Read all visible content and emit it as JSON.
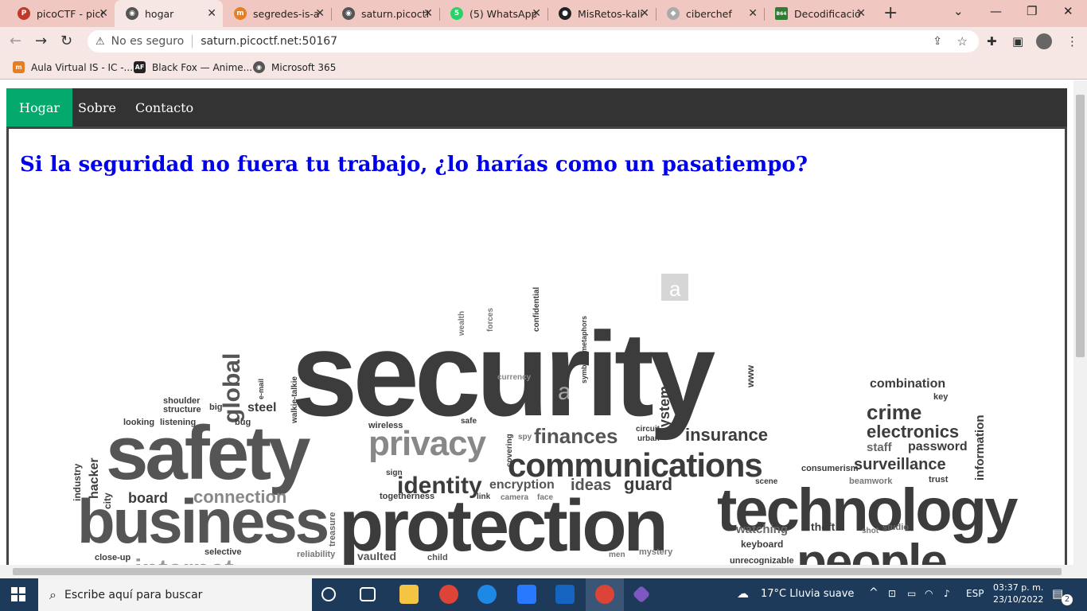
{
  "tabs": [
    {
      "title": "picoCTF - picoGym",
      "color": "#c0392b",
      "glyph": "P"
    },
    {
      "title": "hogar",
      "color": "#555",
      "glyph": "◉"
    },
    {
      "title": "segredes-is-a",
      "color": "#e67e22",
      "glyph": "m"
    },
    {
      "title": "saturn.picoctf",
      "color": "#555",
      "glyph": "◉"
    },
    {
      "title": "(5) WhatsApp",
      "color": "#25d366",
      "glyph": "5"
    },
    {
      "title": "MisRetos-kali",
      "color": "#222",
      "glyph": "●"
    },
    {
      "title": "ciberchef",
      "color": "#aaa",
      "glyph": "◆"
    },
    {
      "title": "Decodificación",
      "color": "#2e7d32",
      "glyph": "B64"
    }
  ],
  "address": {
    "security": "No es seguro",
    "url": "saturn.picoctf.net:50167"
  },
  "bookmarks": [
    {
      "label": "Aula Virtual IS - IC -...",
      "color": "#e67e22",
      "glyph": "m"
    },
    {
      "label": "Black Fox — Anime...",
      "color": "#222",
      "glyph": "AF"
    },
    {
      "label": "Microsoft 365",
      "color": "#555",
      "glyph": "◉"
    }
  ],
  "page": {
    "nav": [
      {
        "label": "Hogar"
      },
      {
        "label": "Sobre"
      },
      {
        "label": "Contacto"
      }
    ],
    "heading": "Si la seguridad no fuera tu trabajo, ¿lo harías como un pasatiempo?"
  },
  "cloud": {
    "color": "#3c3c3c",
    "big": [
      "security",
      "safety",
      "business",
      "protection",
      "technology",
      "people",
      "communications",
      "privacy",
      "identity",
      "finances",
      "global"
    ],
    "small": [
      "insurance",
      "crime",
      "electronics",
      "combination",
      "surveillance",
      "password",
      "staff",
      "information",
      "encryption",
      "ideas",
      "guard",
      "connection",
      "board",
      "hacker",
      "industry",
      "city",
      "steel",
      "treasure",
      "vaulted",
      "child",
      "selective",
      "reliability",
      "watching",
      "theft",
      "studio",
      "keyboard",
      "unrecognizable",
      "mystery",
      "men",
      "currency",
      "system",
      "confidential",
      "forces",
      "wealth",
      "symbols/metaphors",
      "www",
      "listening",
      "looking",
      "shoulder",
      "structure",
      "big",
      "bug",
      "e-mail",
      "walkie-talkie",
      "wireless",
      "safe",
      "spy",
      "covering",
      "sign",
      "togetherness",
      "link",
      "camera",
      "face",
      "close-up",
      "circuit",
      "urban",
      "consumerism",
      "beamwork",
      "trust",
      "key",
      "scene",
      "shot",
      "internet"
    ]
  },
  "taskbar": {
    "search": "Escribe aquí para buscar",
    "weather": "17°C  Lluvia suave",
    "lang": "ESP",
    "time": "03:37 p. m.",
    "date": "23/10/2022",
    "notif": "2"
  }
}
